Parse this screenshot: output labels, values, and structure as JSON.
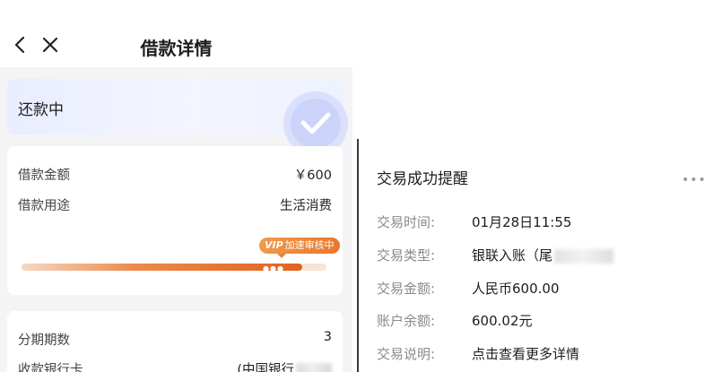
{
  "header": {
    "title": "借款详情"
  },
  "status": {
    "text": "还款中"
  },
  "loan_info": {
    "amount_label": "借款金额",
    "amount_value": "￥600",
    "purpose_label": "借款用途",
    "purpose_value": "生活消费"
  },
  "review": {
    "badge_vip": "VIP",
    "badge_text": "加速审核中",
    "progress": 0.92
  },
  "installment": {
    "periods_label": "分期期数",
    "periods_value": "3",
    "bank_label": "收款银行卡",
    "bank_value": "(中国银行"
  },
  "message": {
    "title": "交易成功提醒",
    "time_label": "交易时间:",
    "time_value": "01月28日11:55",
    "type_label": "交易类型:",
    "type_value": "银联入账（尾",
    "amount_label": "交易金额:",
    "amount_value": "人民币600.00",
    "balance_label": "账户余额:",
    "balance_value": "600.02元",
    "desc_label": "交易说明:",
    "desc_value": "点击查看更多详情"
  },
  "colors": {
    "accent_orange": "#e8762d",
    "status_blue": "#e9edff",
    "check_blue": "#c5cffb"
  }
}
